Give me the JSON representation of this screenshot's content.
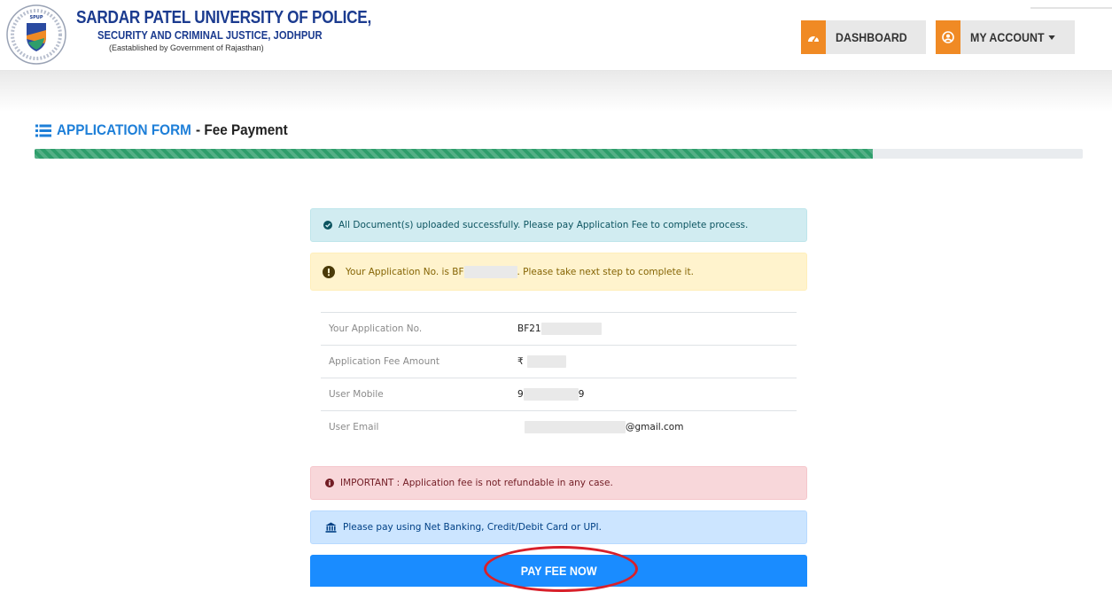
{
  "header": {
    "brand_line1": "SARDAR PATEL UNIVERSITY OF POLICE,",
    "brand_line2": "SECURITY AND CRIMINAL JUSTICE, JODHPUR",
    "brand_line3": "(Eastablished by Government of Rajasthan)",
    "logo_text": "SPUP",
    "dashboard_label": "DASHBOARD",
    "dashboard_icon": "tachometer-icon",
    "account_label": "MY ACCOUNT",
    "account_icon": "user-circle-icon"
  },
  "form": {
    "title_main": "APPLICATION FORM",
    "title_sub": " - Fee Payment",
    "progress_percent": 80
  },
  "alerts": {
    "success_text": "All Document(s) uploaded successfully. Please pay Application Fee to complete process.",
    "warning_prefix": "Your Application No. is BF",
    "warning_suffix": ". Please take next step to complete it.",
    "danger_text": "IMPORTANT : Application fee is not refundable in any case.",
    "info_text": "Please pay using Net Banking, Credit/Debit Card or UPI."
  },
  "details": {
    "rows": [
      {
        "label": "Your Application No.",
        "value": "BF21"
      },
      {
        "label": "Application Fee Amount",
        "value": "₹"
      },
      {
        "label": "User Mobile",
        "value_prefix": "9",
        "value_suffix": "9"
      },
      {
        "label": "User Email",
        "value": "@gmail.com"
      }
    ]
  },
  "actions": {
    "pay_label": "PAY FEE NOW"
  },
  "colors": {
    "brand_blue": "#1b3b8f",
    "accent_orange": "#f08a24",
    "title_blue": "#1e7fd8",
    "progress_green": "#2e9e6b",
    "pay_blue": "#1a8cff",
    "highlight_red": "#d8202a"
  }
}
